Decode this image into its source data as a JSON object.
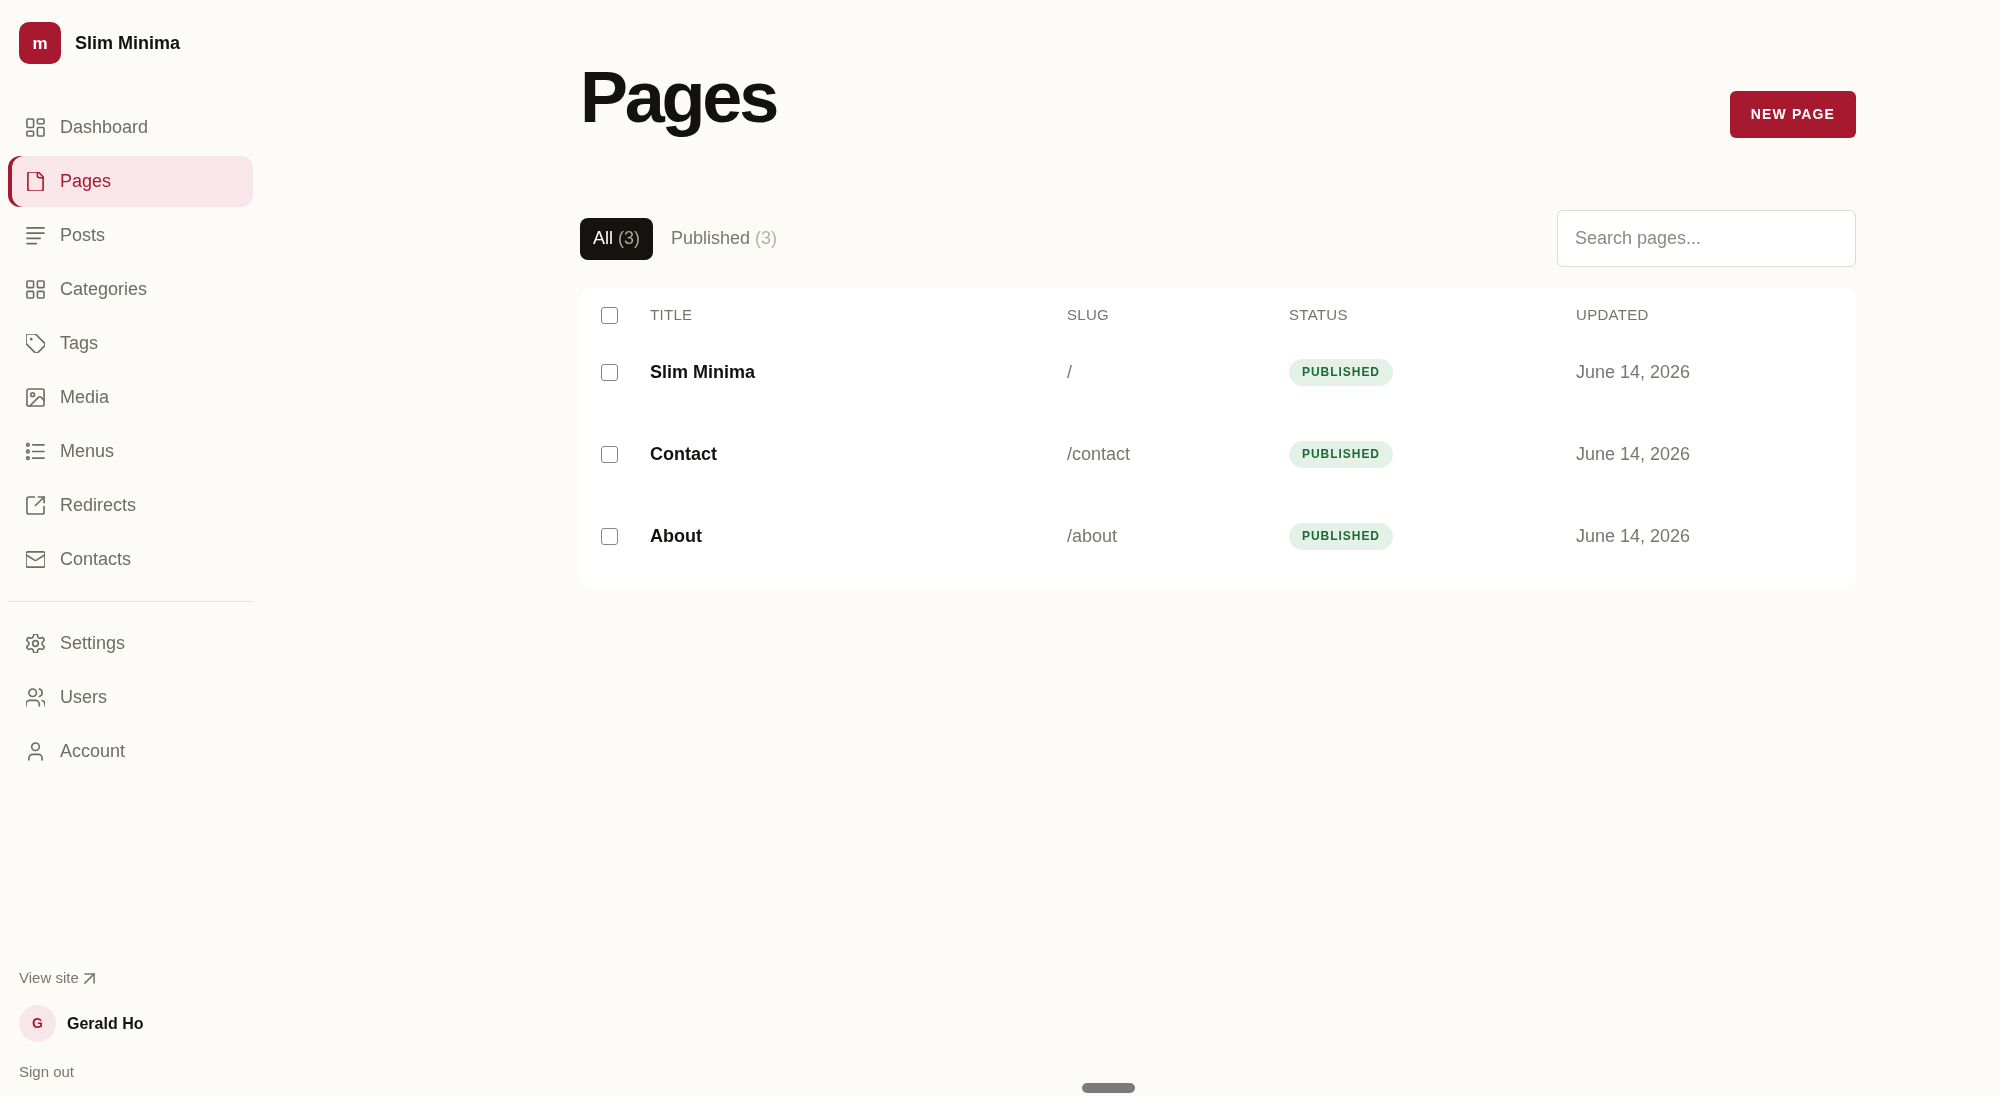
{
  "sidebar": {
    "brand": {
      "logo": "m",
      "name": "Slim Minima"
    },
    "nav_groups": [
      {
        "items": [
          {
            "label": "Dashboard",
            "selected": false
          },
          {
            "label": "Pages",
            "selected": true
          },
          {
            "label": "Posts",
            "selected": false
          },
          {
            "label": "Categories",
            "selected": false
          },
          {
            "label": "Tags",
            "selected": false
          },
          {
            "label": "Media",
            "selected": false
          },
          {
            "label": "Menus",
            "selected": false
          },
          {
            "label": "Redirects",
            "selected": false
          },
          {
            "label": "Contacts",
            "selected": false
          }
        ]
      },
      {
        "items": [
          {
            "label": "Settings",
            "selected": false
          },
          {
            "label": "Users",
            "selected": false
          },
          {
            "label": "Account",
            "selected": false
          }
        ]
      }
    ],
    "footer": {
      "view_site": "View site",
      "user": {
        "initial": "G",
        "name": "Gerald Ho"
      },
      "sign_out": "Sign out"
    }
  },
  "main": {
    "title": "Pages",
    "new_button": "NEW PAGE",
    "filters": [
      {
        "label": "All",
        "count": "(3)",
        "selected": true
      },
      {
        "label": "Published",
        "count": "(3)",
        "selected": false
      }
    ],
    "search": {
      "placeholder": "Search pages..."
    },
    "table": {
      "select_all": {
        "checked": false
      },
      "columns": [
        "TITLE",
        "SLUG",
        "STATUS",
        "UPDATED"
      ],
      "rows": [
        {
          "checked": false,
          "title": "Slim Minima",
          "slug": "/",
          "status": "PUBLISHED",
          "updated": "June 14, 2026"
        },
        {
          "checked": false,
          "title": "Contact",
          "slug": "/contact",
          "status": "PUBLISHED",
          "updated": "June 14, 2026"
        },
        {
          "checked": false,
          "title": "About",
          "slug": "/about",
          "status": "PUBLISHED",
          "updated": "June 14, 2026"
        }
      ]
    }
  }
}
